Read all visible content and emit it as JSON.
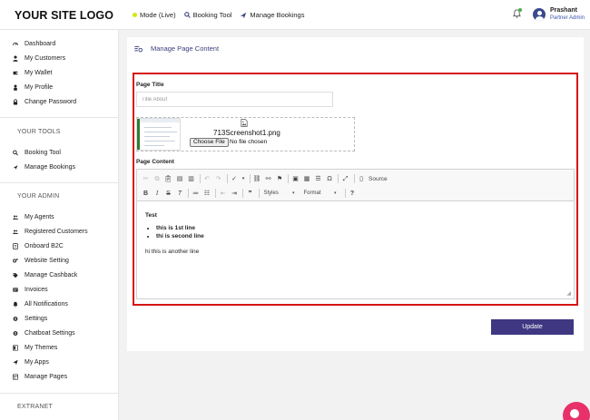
{
  "header": {
    "logo": "YOUR SITE LOGO",
    "mode": "Mode (Live)",
    "booking_tool": "Booking Tool",
    "manage_bookings": "Manage Bookings",
    "user_name": "Prashant",
    "user_role": "Partner Admin"
  },
  "sidebar": {
    "items_main": [
      {
        "label": "Dashboard",
        "icon": "dashboard-icon"
      },
      {
        "label": "My Customers",
        "icon": "user-icon"
      },
      {
        "label": "My Wallet",
        "icon": "wallet-icon"
      },
      {
        "label": "My Profile",
        "icon": "profile-icon"
      },
      {
        "label": "Change Password",
        "icon": "lock-icon"
      }
    ],
    "section_tools": "YOUR TOOLS",
    "items_tools": [
      {
        "label": "Booking Tool",
        "icon": "search-icon"
      },
      {
        "label": "Manage Bookings",
        "icon": "plane-icon"
      }
    ],
    "section_admin": "YOUR ADMIN",
    "items_admin": [
      {
        "label": "My Agents",
        "icon": "users-icon"
      },
      {
        "label": "Registered Customers",
        "icon": "users-icon"
      },
      {
        "label": "Onboard B2C",
        "icon": "document-icon"
      },
      {
        "label": "Website Setting",
        "icon": "gears-icon"
      },
      {
        "label": "Manage Cashback",
        "icon": "tag-icon"
      },
      {
        "label": "Invoices",
        "icon": "invoice-icon"
      },
      {
        "label": "All Notifications",
        "icon": "bell-icon"
      },
      {
        "label": "Settings",
        "icon": "gear-icon"
      },
      {
        "label": "Chatboat Settings",
        "icon": "gear-icon"
      },
      {
        "label": "My Themes",
        "icon": "theme-icon"
      },
      {
        "label": "My Apps",
        "icon": "send-icon"
      },
      {
        "label": "Manage Pages",
        "icon": "pages-icon"
      }
    ],
    "section_extranet": "EXTRANET"
  },
  "main": {
    "heading": "Manage Page Content",
    "page_title_label": "Page Title",
    "page_title_placeholder": "Title About",
    "file_name": "713Screenshot1.png",
    "choose_file": "Choose File",
    "no_file": "No file chosen",
    "page_content_label": "Page Content",
    "toolbar": {
      "source": "Source",
      "styles": "Styles",
      "format": "Format"
    },
    "content": {
      "line1": "Test",
      "bullets": [
        "this is 1st line",
        "thi is second line"
      ],
      "line4": "hi this is another line"
    },
    "update_button": "Update"
  },
  "colors": {
    "accent": "#3f3782",
    "highlight_border": "#d61414",
    "live_dot": "#d4e80f",
    "chat_button": "#e8316a"
  }
}
